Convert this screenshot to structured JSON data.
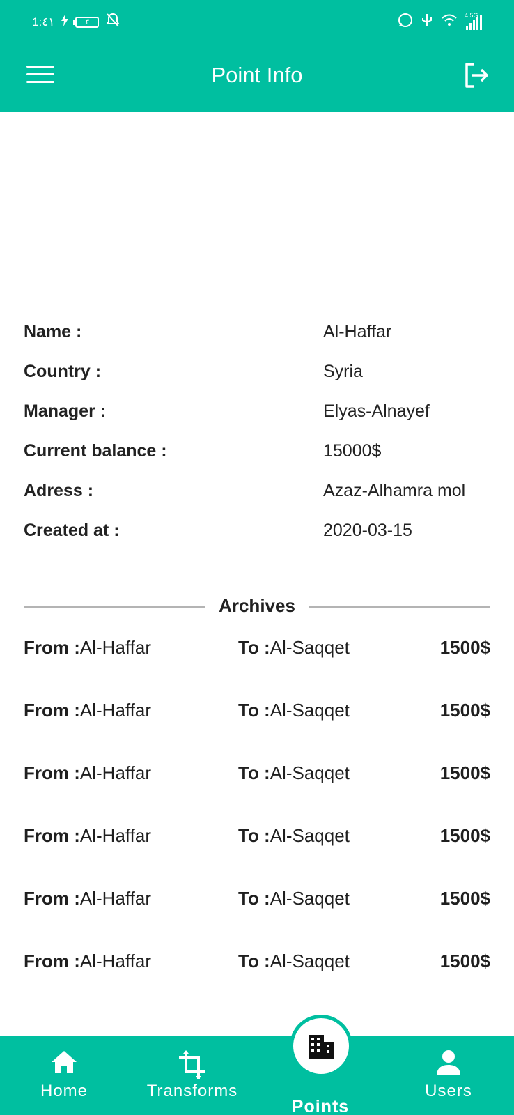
{
  "status": {
    "time": "1:٤١",
    "battery": "٣",
    "network": "4.5G"
  },
  "appbar": {
    "title": "Point Info"
  },
  "info": [
    {
      "label": "Name :",
      "value": "Al-Haffar"
    },
    {
      "label": "Country :",
      "value": "Syria"
    },
    {
      "label": "Manager :",
      "value": "Elyas-Alnayef"
    },
    {
      "label": "Current balance :",
      "value": "15000$"
    },
    {
      "label": "Adress :",
      "value": "Azaz-Alhamra mol"
    },
    {
      "label": "Created at :",
      "value": "2020-03-15"
    }
  ],
  "archives": {
    "title": "Archives",
    "from_label": "From :",
    "to_label": "To :",
    "rows": [
      {
        "from": "Al-Haffar",
        "to": "Al-Saqqet",
        "amount": "1500$"
      },
      {
        "from": "Al-Haffar",
        "to": "Al-Saqqet",
        "amount": "1500$"
      },
      {
        "from": "Al-Haffar",
        "to": "Al-Saqqet",
        "amount": "1500$"
      },
      {
        "from": "Al-Haffar",
        "to": "Al-Saqqet",
        "amount": "1500$"
      },
      {
        "from": "Al-Haffar",
        "to": "Al-Saqqet",
        "amount": "1500$"
      },
      {
        "from": "Al-Haffar",
        "to": "Al-Saqqet",
        "amount": "1500$"
      }
    ]
  },
  "nav": {
    "home": "Home",
    "transforms": "Transforms",
    "points": "Points",
    "users": "Users"
  },
  "colors": {
    "primary": "#00BFA0",
    "background": "#FFFFFF",
    "text": "#1F1F1F"
  },
  "icons": {
    "menu": "menu-icon",
    "logout": "logout-icon",
    "home": "home-icon",
    "transforms": "crop-icon",
    "points": "building-icon",
    "users": "person-icon"
  }
}
